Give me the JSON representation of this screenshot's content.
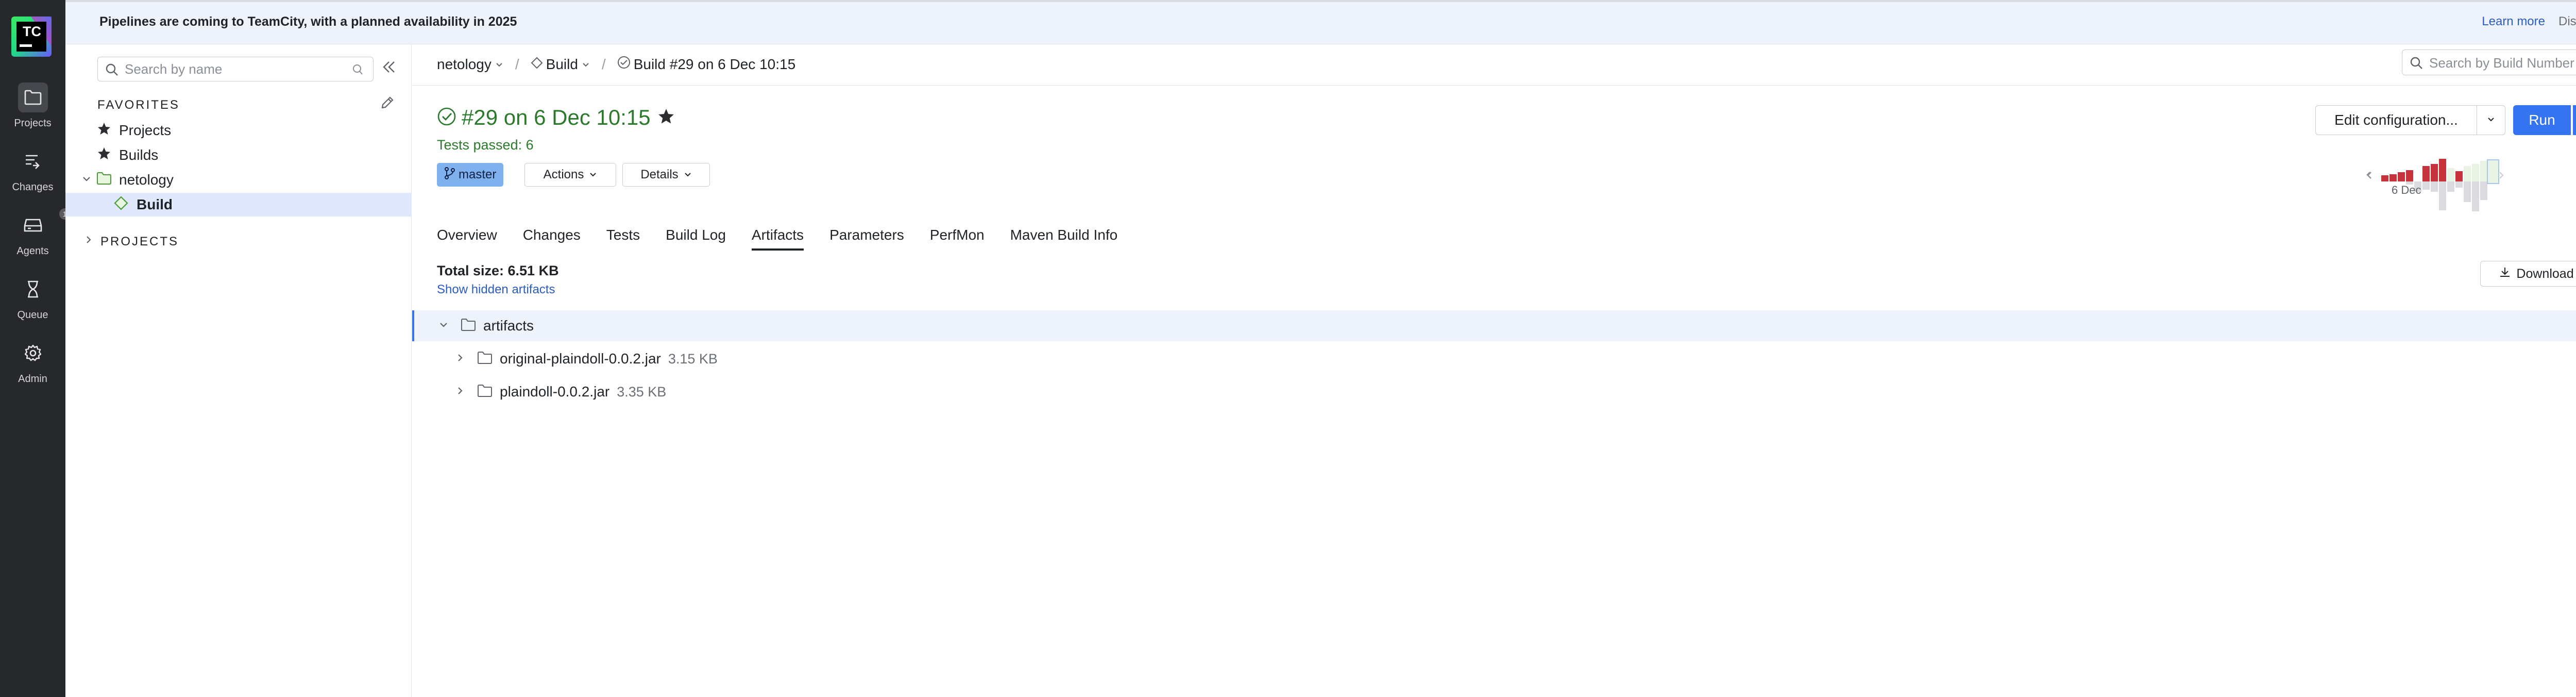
{
  "leftnav": {
    "logo_text": "TC",
    "items": [
      {
        "label": "Projects",
        "icon": "folder-icon"
      },
      {
        "label": "Changes",
        "icon": "changes-icon"
      },
      {
        "label": "Agents",
        "icon": "agents-icon",
        "badge": "1"
      },
      {
        "label": "Queue",
        "icon": "hourglass-icon"
      },
      {
        "label": "Admin",
        "icon": "gear-icon"
      }
    ]
  },
  "banner": {
    "text": "Pipelines are coming to TeamCity, with a planned availability in 2025",
    "learn_more": "Learn more",
    "dismiss": "Dismiss"
  },
  "sidebar": {
    "search_placeholder": "Search by name",
    "favorites_title": "FAVORITES",
    "favorites": [
      {
        "label": "Projects",
        "icon": "star-icon"
      },
      {
        "label": "Builds",
        "icon": "star-icon"
      }
    ],
    "tree": {
      "project": "netology",
      "build": "Build"
    },
    "projects_title": "PROJECTS"
  },
  "breadcrumb": {
    "project": "netology",
    "build_config": "Build",
    "build": "Build #29 on 6 Dec 10:15",
    "search_placeholder": "Search by Build Number"
  },
  "build": {
    "title": "#29 on 6 Dec 10:15",
    "status": "Tests passed: 6",
    "branch": "master",
    "actions": "Actions",
    "details": "Details",
    "edit_config": "Edit configuration...",
    "run": "Run",
    "run_more": "...",
    "history_label": "6 Dec",
    "colors": {
      "success": "#2b7a2b",
      "accent": "#3574f0",
      "failed": "#c8323c"
    }
  },
  "tabs": [
    "Overview",
    "Changes",
    "Tests",
    "Build Log",
    "Artifacts",
    "Parameters",
    "PerfMon",
    "Maven Build Info"
  ],
  "active_tab": "Artifacts",
  "artifacts": {
    "total_size": "Total size: 6.51 KB",
    "show_hidden": "Show hidden artifacts",
    "download_all": "Download all",
    "root": "artifacts",
    "items": [
      {
        "name": "original-plaindoll-0.0.2.jar",
        "size": "3.15 KB"
      },
      {
        "name": "plaindoll-0.0.2.jar",
        "size": "3.35 KB"
      }
    ]
  }
}
